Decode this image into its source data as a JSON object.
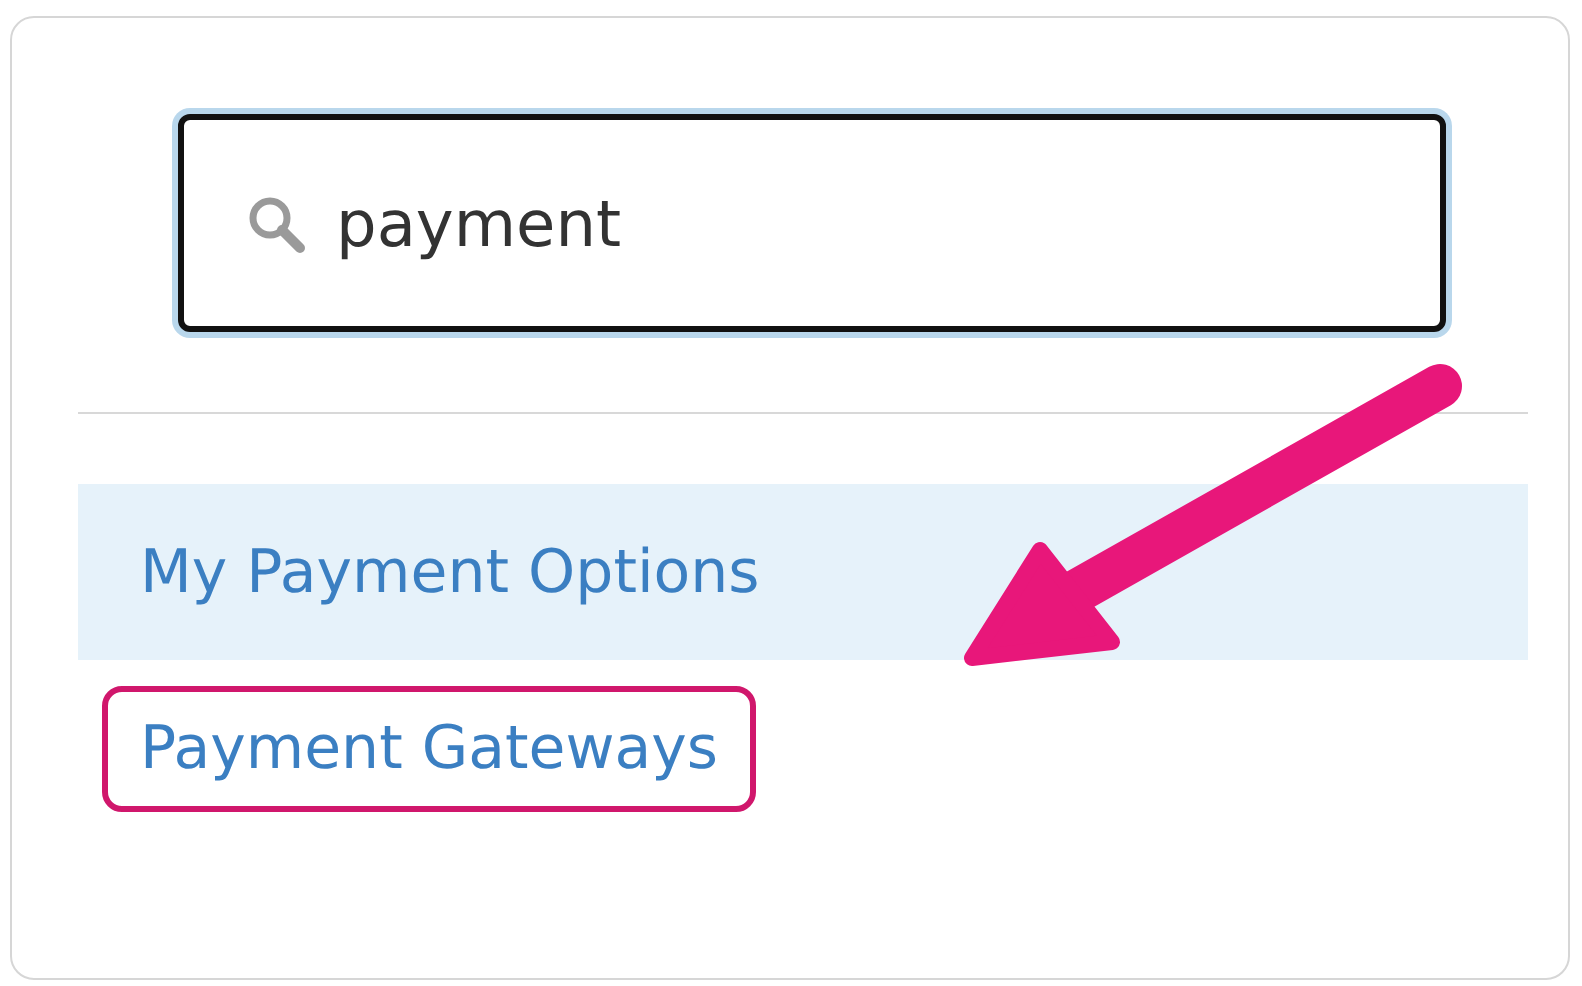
{
  "search": {
    "value": "payment"
  },
  "results": [
    {
      "label": "My Payment Options",
      "selected": true,
      "annotated": false
    },
    {
      "label": "Payment Gateways",
      "selected": false,
      "annotated": true
    }
  ]
}
